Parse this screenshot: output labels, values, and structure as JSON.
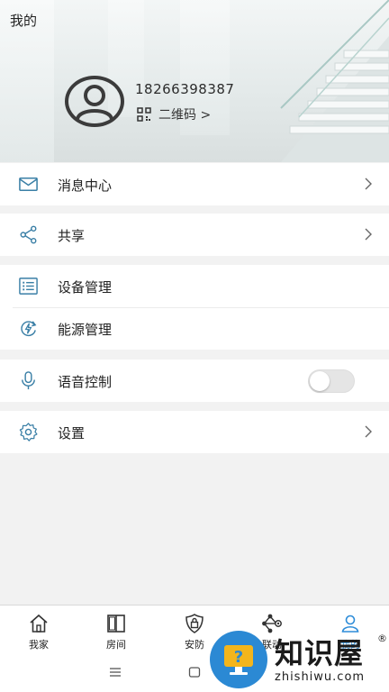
{
  "header": {
    "title": "我的",
    "phone": "18266398387",
    "qr_label": "二维码 >"
  },
  "menu": {
    "messages": "消息中心",
    "share": "共享",
    "devices": "设备管理",
    "energy": "能源管理",
    "voice": "语音控制",
    "voice_enabled": false,
    "settings": "设置"
  },
  "tabs": [
    {
      "label": "我家",
      "icon": "home-icon"
    },
    {
      "label": "房间",
      "icon": "door-icon"
    },
    {
      "label": "安防",
      "icon": "shield-lock-icon"
    },
    {
      "label": "联动",
      "icon": "linkage-icon"
    },
    {
      "label": "我的",
      "icon": "user-icon",
      "active": true
    }
  ],
  "colors": {
    "accent": "#2d8cd8",
    "icon": "#3a7fa6"
  },
  "watermark": {
    "title": "知识屋",
    "url": "zhishiwu.com",
    "mark": "®"
  }
}
